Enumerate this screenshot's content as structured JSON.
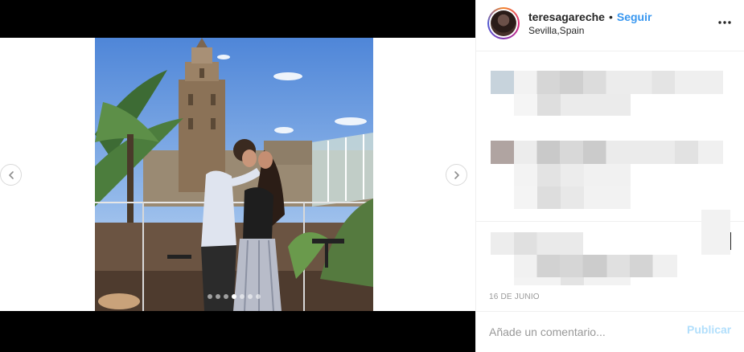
{
  "post": {
    "username": "teresagareche",
    "separator": "•",
    "follow_label": "Seguir",
    "location": "Sevilla,Spain",
    "date": "16 DE JUNIO"
  },
  "carousel": {
    "slide_count": 7,
    "active_index": 3
  },
  "comment_form": {
    "placeholder": "Añade un comentario...",
    "post_label": "Publicar"
  },
  "icons": {
    "prev": "chevron-left-icon",
    "next": "chevron-right-icon",
    "more": "more-options-icon"
  },
  "colors": {
    "link": "#3897f0",
    "disabled_button": "#b2dffc",
    "muted_text": "#999999"
  }
}
